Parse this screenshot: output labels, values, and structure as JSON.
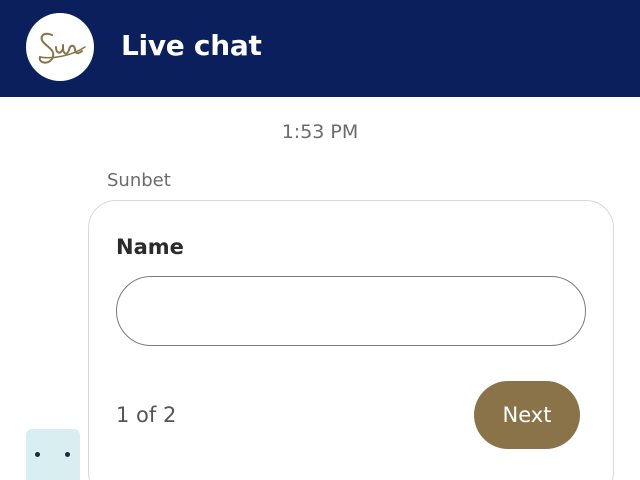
{
  "header": {
    "title": "Live chat",
    "logo_icon": "sunbet-logo-icon",
    "background_color": "#0a1f5c"
  },
  "conversation": {
    "timestamp": "1:53 PM",
    "sender": "Sunbet"
  },
  "form": {
    "field_label": "Name",
    "name_value": "",
    "name_placeholder": "",
    "page_indicator": "1 of 2",
    "next_label": "Next",
    "accent_color": "#8b7349"
  },
  "typing_indicator": {
    "icon": "typing-dots-icon"
  }
}
